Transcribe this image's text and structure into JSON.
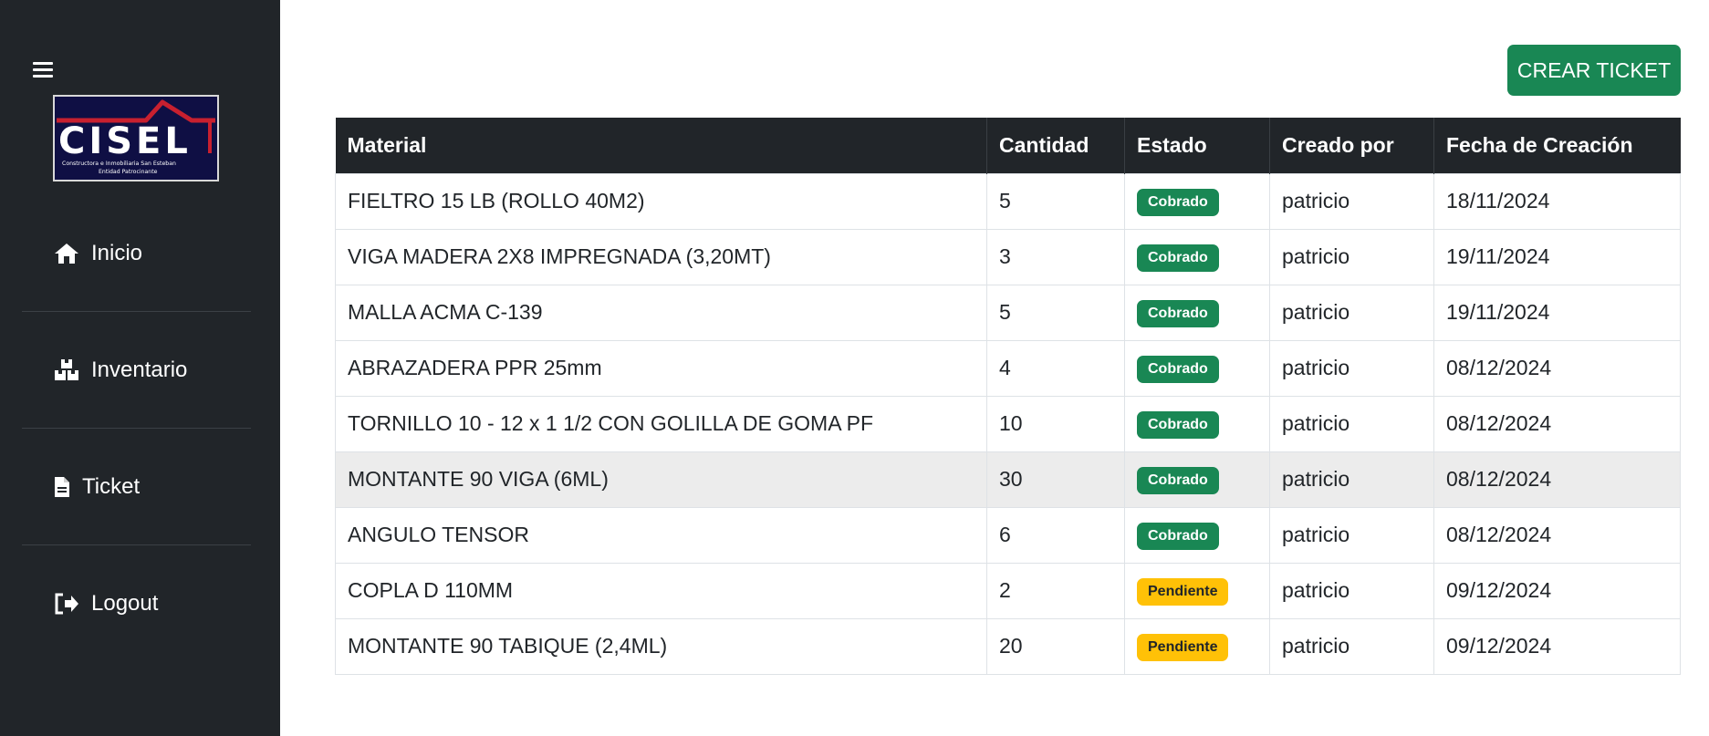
{
  "sidebar": {
    "logo": {
      "text": "CISEL",
      "line1": "Constructora e Inmobiliaria San Esteban",
      "line2": "Entidad Patrocinante"
    },
    "items": [
      {
        "label": "Inicio",
        "icon": "home-icon"
      },
      {
        "label": "Inventario",
        "icon": "boxes-icon"
      },
      {
        "label": "Ticket",
        "icon": "file-icon"
      },
      {
        "label": "Logout",
        "icon": "logout-icon"
      }
    ]
  },
  "toolbar": {
    "create_label": "CREAR TICKET"
  },
  "table": {
    "headers": [
      "Material",
      "Cantidad",
      "Estado",
      "Creado por",
      "Fecha de Creación"
    ],
    "rows": [
      {
        "material": "FIELTRO 15 LB (ROLLO 40M2)",
        "cantidad": "5",
        "estado": "Cobrado",
        "creado_por": "patricio",
        "fecha": "18/11/2024"
      },
      {
        "material": "VIGA MADERA 2X8 IMPREGNADA (3,20MT)",
        "cantidad": "3",
        "estado": "Cobrado",
        "creado_por": "patricio",
        "fecha": "19/11/2024"
      },
      {
        "material": "MALLA ACMA C-139",
        "cantidad": "5",
        "estado": "Cobrado",
        "creado_por": "patricio",
        "fecha": "19/11/2024"
      },
      {
        "material": "ABRAZADERA PPR 25mm",
        "cantidad": "4",
        "estado": "Cobrado",
        "creado_por": "patricio",
        "fecha": "08/12/2024"
      },
      {
        "material": "TORNILLO 10 - 12 x 1 1/2 CON GOLILLA DE GOMA PF",
        "cantidad": "10",
        "estado": "Cobrado",
        "creado_por": "patricio",
        "fecha": "08/12/2024"
      },
      {
        "material": "MONTANTE 90 VIGA (6ML)",
        "cantidad": "30",
        "estado": "Cobrado",
        "creado_por": "patricio",
        "fecha": "08/12/2024"
      },
      {
        "material": "ANGULO TENSOR",
        "cantidad": "6",
        "estado": "Cobrado",
        "creado_por": "patricio",
        "fecha": "08/12/2024"
      },
      {
        "material": "COPLA D 110MM",
        "cantidad": "2",
        "estado": "Pendiente",
        "creado_por": "patricio",
        "fecha": "09/12/2024"
      },
      {
        "material": "MONTANTE 90 TABIQUE (2,4ML)",
        "cantidad": "20",
        "estado": "Pendiente",
        "creado_por": "patricio",
        "fecha": "09/12/2024"
      }
    ]
  },
  "colors": {
    "sidebar_bg": "#212529",
    "success": "#198754",
    "warning": "#ffc107",
    "logo_red": "#c8202f",
    "logo_bg": "#0f0f44"
  }
}
